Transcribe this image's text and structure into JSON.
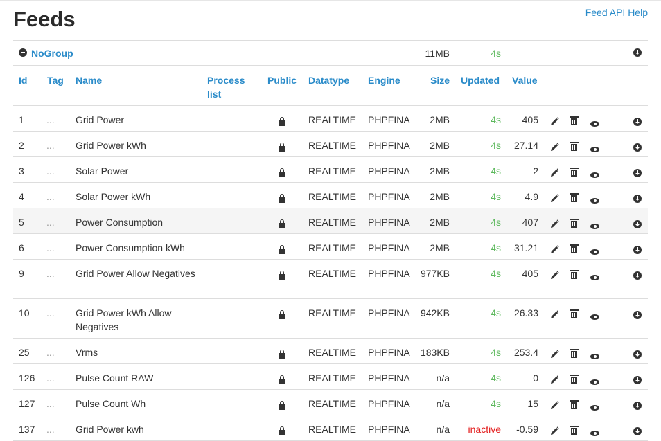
{
  "page": {
    "title": "Feeds",
    "api_help": "Feed API Help"
  },
  "group": {
    "name": "NoGroup",
    "size": "11MB",
    "updated": "4s"
  },
  "columns": {
    "id": "Id",
    "tag": "Tag",
    "name": "Name",
    "process_list": "Process list",
    "public": "Public",
    "datatype": "Datatype",
    "engine": "Engine",
    "size": "Size",
    "updated": "Updated",
    "value": "Value"
  },
  "icons": {
    "group_toggle": "minus-circle-icon",
    "public": "lock-icon",
    "edit": "pencil-icon",
    "delete": "trash-icon",
    "view": "eye-icon",
    "download": "download-icon"
  },
  "colors": {
    "link": "#2a8bc9",
    "updated_ok": "#5cb85c",
    "inactive": "#e31d1d"
  },
  "feeds": [
    {
      "id": "1",
      "tag": "...",
      "name": "Grid Power",
      "datatype": "REALTIME",
      "engine": "PHPFINA",
      "size": "2MB",
      "updated": "4s",
      "value": "405"
    },
    {
      "id": "2",
      "tag": "...",
      "name": "Grid Power kWh",
      "datatype": "REALTIME",
      "engine": "PHPFINA",
      "size": "2MB",
      "updated": "4s",
      "value": "27.14"
    },
    {
      "id": "3",
      "tag": "...",
      "name": "Solar Power",
      "datatype": "REALTIME",
      "engine": "PHPFINA",
      "size": "2MB",
      "updated": "4s",
      "value": "2"
    },
    {
      "id": "4",
      "tag": "...",
      "name": "Solar Power kWh",
      "datatype": "REALTIME",
      "engine": "PHPFINA",
      "size": "2MB",
      "updated": "4s",
      "value": "4.9"
    },
    {
      "id": "5",
      "tag": "...",
      "name": "Power Consumption",
      "datatype": "REALTIME",
      "engine": "PHPFINA",
      "size": "2MB",
      "updated": "4s",
      "value": "407"
    },
    {
      "id": "6",
      "tag": "...",
      "name": "Power Consumption kWh",
      "datatype": "REALTIME",
      "engine": "PHPFINA",
      "size": "2MB",
      "updated": "4s",
      "value": "31.21"
    },
    {
      "id": "9",
      "tag": "...",
      "name": "Grid Power Allow Negatives",
      "datatype": "REALTIME",
      "engine": "PHPFINA",
      "size": "977KB",
      "updated": "4s",
      "value": "405"
    },
    {
      "id": "10",
      "tag": "...",
      "name": "Grid Power kWh Allow Negatives",
      "datatype": "REALTIME",
      "engine": "PHPFINA",
      "size": "942KB",
      "updated": "4s",
      "value": "26.33"
    },
    {
      "id": "25",
      "tag": "...",
      "name": "Vrms",
      "datatype": "REALTIME",
      "engine": "PHPFINA",
      "size": "183KB",
      "updated": "4s",
      "value": "253.4"
    },
    {
      "id": "126",
      "tag": "...",
      "name": "Pulse Count RAW",
      "datatype": "REALTIME",
      "engine": "PHPFINA",
      "size": "n/a",
      "updated": "4s",
      "value": "0"
    },
    {
      "id": "127",
      "tag": "...",
      "name": "Pulse Count Wh",
      "datatype": "REALTIME",
      "engine": "PHPFINA",
      "size": "n/a",
      "updated": "4s",
      "value": "15"
    },
    {
      "id": "137",
      "tag": "...",
      "name": "Grid Power kwh",
      "datatype": "REALTIME",
      "engine": "PHPFINA",
      "size": "n/a",
      "updated": "inactive",
      "value": "-0.59"
    }
  ]
}
